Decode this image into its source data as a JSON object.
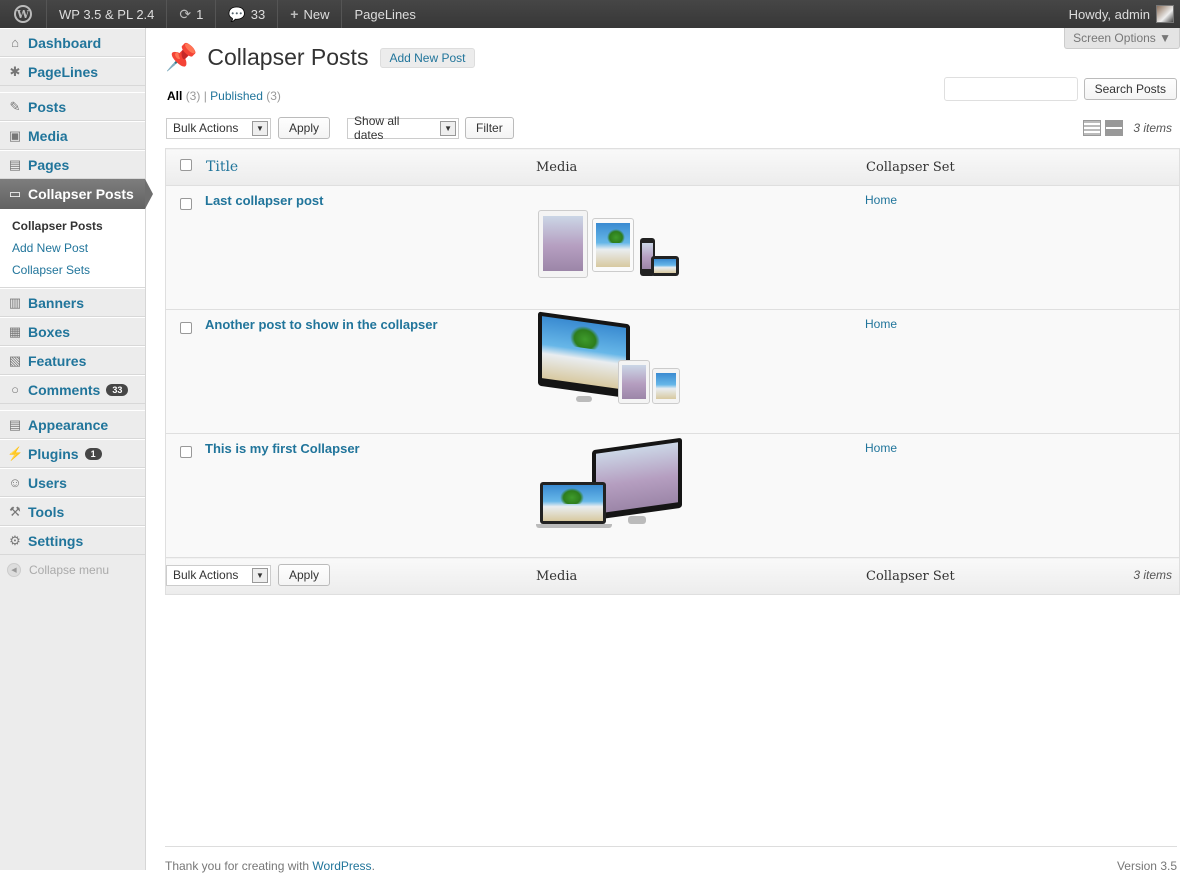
{
  "adminbar": {
    "site_name": "WP 3.5 & PL 2.4",
    "updates_count": "1",
    "comments_count": "33",
    "new_label": "New",
    "pagelines_label": "PageLines",
    "howdy": "Howdy, admin"
  },
  "sidebar": {
    "items": [
      {
        "label": "Dashboard"
      },
      {
        "label": "PageLines"
      },
      {
        "label": "Posts"
      },
      {
        "label": "Media"
      },
      {
        "label": "Pages"
      },
      {
        "label": "Collapser Posts"
      },
      {
        "label": "Banners"
      },
      {
        "label": "Boxes"
      },
      {
        "label": "Features"
      },
      {
        "label": "Comments",
        "count": "33"
      },
      {
        "label": "Appearance"
      },
      {
        "label": "Plugins",
        "count": "1"
      },
      {
        "label": "Users"
      },
      {
        "label": "Tools"
      },
      {
        "label": "Settings"
      }
    ],
    "submenu": [
      "Collapser Posts",
      "Add New Post",
      "Collapser Sets"
    ],
    "collapse_label": "Collapse menu"
  },
  "header": {
    "title": "Collapser Posts",
    "add_new": "Add New Post",
    "screen_options": "Screen Options ▼"
  },
  "filters": {
    "all": "All",
    "all_count": "(3)",
    "published": "Published",
    "published_count": "(3)",
    "separator": "|"
  },
  "search": {
    "button": "Search Posts"
  },
  "tablenav": {
    "bulk_actions": "Bulk Actions",
    "apply": "Apply",
    "dates": "Show all dates",
    "filter": "Filter",
    "items": "3 items"
  },
  "table": {
    "columns": [
      "Title",
      "Media",
      "Collapser Set"
    ],
    "rows": [
      {
        "title": "Last collapser post",
        "set": "Home"
      },
      {
        "title": "Another post to show in the collapser",
        "set": "Home"
      },
      {
        "title": "This is my first Collapser",
        "set": "Home"
      }
    ]
  },
  "footer": {
    "thanks": "Thank you for creating with",
    "wp_link": "WordPress",
    "period": ".",
    "version": "Version 3.5"
  }
}
